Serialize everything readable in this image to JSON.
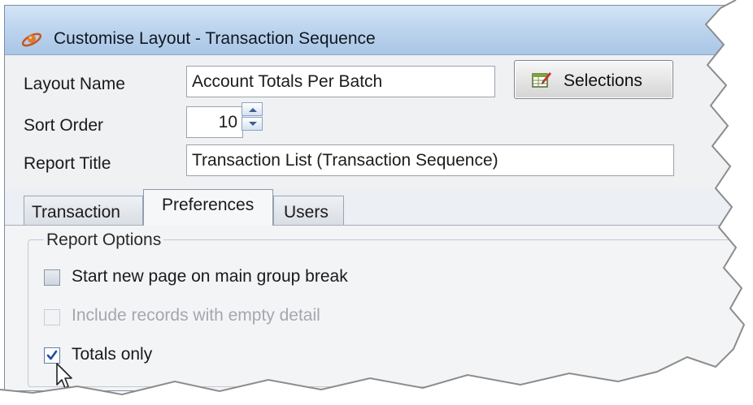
{
  "window": {
    "title": "Customise Layout - Transaction Sequence",
    "app_icon": "satellite-icon"
  },
  "form": {
    "layout_name": {
      "label": "Layout Name",
      "value": "Account Totals Per Batch"
    },
    "sort_order": {
      "label": "Sort Order",
      "value": "10"
    },
    "report_title": {
      "label": "Report Title",
      "value": "Transaction List (Transaction Sequence)"
    },
    "selections_button": {
      "label": "Selections",
      "icon": "table-edit-icon"
    }
  },
  "tabs": [
    {
      "label": "Transaction",
      "active": false
    },
    {
      "label": "Preferences",
      "active": true
    },
    {
      "label": "Users",
      "active": false
    }
  ],
  "report_options": {
    "title": "Report Options",
    "options": [
      {
        "label": "Start new page on main group break",
        "checked": false,
        "enabled": true
      },
      {
        "label": "Include records with empty detail",
        "checked": false,
        "enabled": false
      },
      {
        "label": "Totals only",
        "checked": true,
        "enabled": true
      }
    ]
  },
  "colors": {
    "titlebar": "#bed5ee",
    "panel": "#f3f4f6",
    "check_mark": "#1f4f9c",
    "disabled_text": "#a3a8ae"
  }
}
